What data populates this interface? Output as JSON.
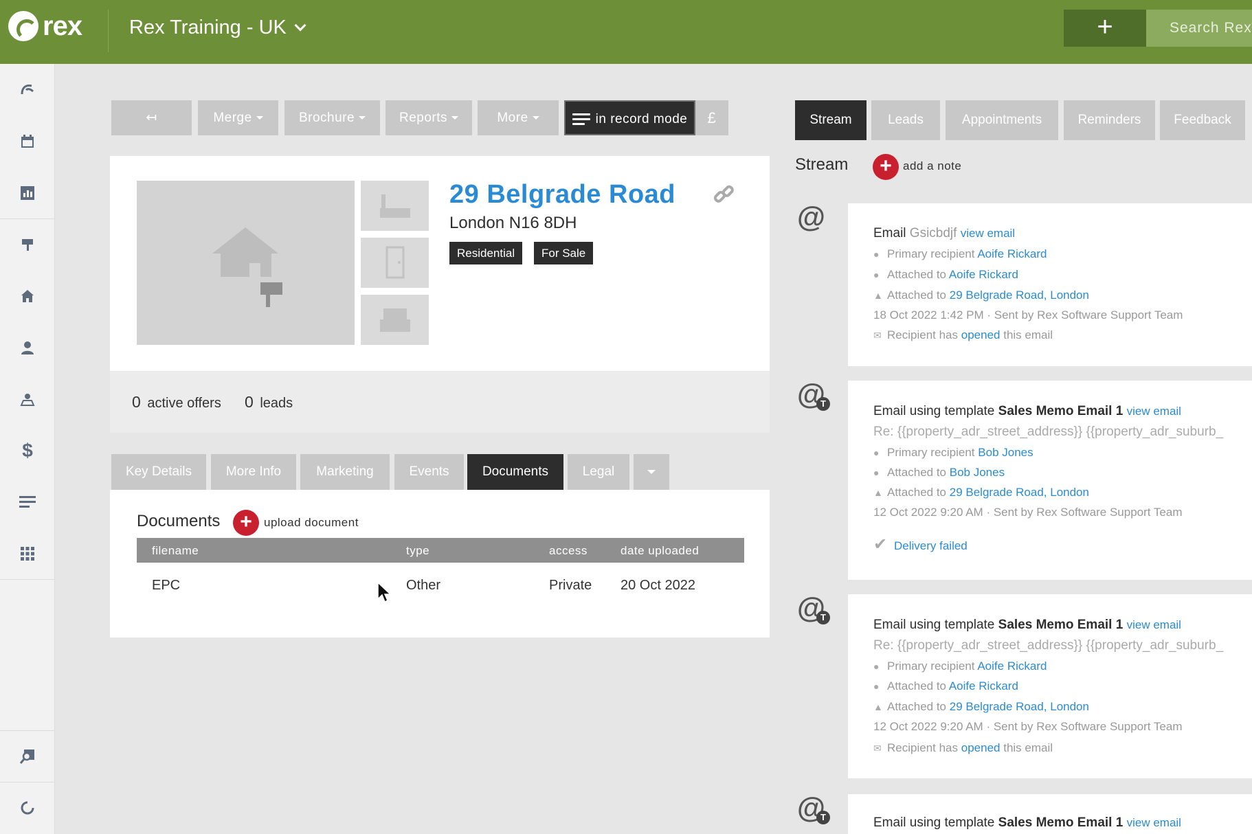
{
  "topbar": {
    "logo_text": "rex",
    "account": "Rex Training - UK",
    "plus": "+",
    "search_placeholder": "Search Rex"
  },
  "sidebar": {
    "items": [
      "rex",
      "calendar",
      "reports",
      "listings",
      "properties",
      "contacts",
      "owners",
      "finance",
      "lists",
      "apps",
      "search",
      "refresh"
    ]
  },
  "toolbar": {
    "back": "↤",
    "merge": "Merge",
    "brochure": "Brochure",
    "reports": "Reports",
    "more": "More",
    "record_mode": "in record mode",
    "pound": "£"
  },
  "property": {
    "title": "29 Belgrade Road",
    "subtitle": "London N16 8DH",
    "tags": [
      "Residential",
      "For Sale"
    ]
  },
  "stats": {
    "offers_count": "0",
    "offers_label": "active offers",
    "leads_count": "0",
    "leads_label": "leads"
  },
  "tabs": [
    "Key Details",
    "More Info",
    "Marketing",
    "Events",
    "Documents",
    "Legal"
  ],
  "active_tab": "Documents",
  "documents": {
    "title": "Documents",
    "add_label": "upload document",
    "columns": [
      "filename",
      "type",
      "access",
      "date uploaded"
    ],
    "rows": [
      {
        "filename": "EPC",
        "type": "Other",
        "access": "Private",
        "date": "20 Oct 2022"
      }
    ]
  },
  "right_tabs": [
    "Stream",
    "Leads",
    "Appointments",
    "Reminders",
    "Feedback"
  ],
  "stream": {
    "title": "Stream",
    "add_label": "add a note",
    "entries": [
      {
        "head_prefix": "Email",
        "head_muted": "Gsicbdjf",
        "view": "view email",
        "primary_label": "Primary recipient",
        "primary_name": "Aoife Rickard",
        "attached_label": "Attached to",
        "attached_contact": "Aoife Rickard",
        "attached_property": "29 Belgrade Road, London",
        "meta": "18 Oct 2022 1:42 PM · Sent by Rex Software Support Team",
        "status_pre": "Recipient has",
        "status_link": "opened",
        "status_post": "this email"
      },
      {
        "head_prefix": "Email using template",
        "head_bold": "Sales Memo Email 1",
        "view": "view email",
        "subject": "Re: {{property_adr_street_address}} {{property_adr_suburb_",
        "primary_label": "Primary recipient",
        "primary_name": "Bob Jones",
        "attached_label": "Attached to",
        "attached_contact": "Bob Jones",
        "attached_property": "29 Belgrade Road, London",
        "meta": "12 Oct 2022 9:20 AM · Sent by Rex Software Support Team",
        "failed": "Delivery failed"
      },
      {
        "head_prefix": "Email using template",
        "head_bold": "Sales Memo Email 1",
        "view": "view email",
        "subject": "Re: {{property_adr_street_address}} {{property_adr_suburb_",
        "primary_label": "Primary recipient",
        "primary_name": "Aoife Rickard",
        "attached_label": "Attached to",
        "attached_contact": "Aoife Rickard",
        "attached_property": "29 Belgrade Road, London",
        "meta": "12 Oct 2022 9:20 AM · Sent by Rex Software Support Team",
        "status_pre": "Recipient has",
        "status_link": "opened",
        "status_post": "this email"
      },
      {
        "head_prefix": "Email using template",
        "head_bold": "Sales Memo Email 1",
        "view": "view email"
      }
    ]
  },
  "colors": {
    "topbar": "#6c8f37",
    "accent_blue": "#2a8bd4",
    "add_red": "#c8202e",
    "dark_button": "#2d2d2d"
  }
}
